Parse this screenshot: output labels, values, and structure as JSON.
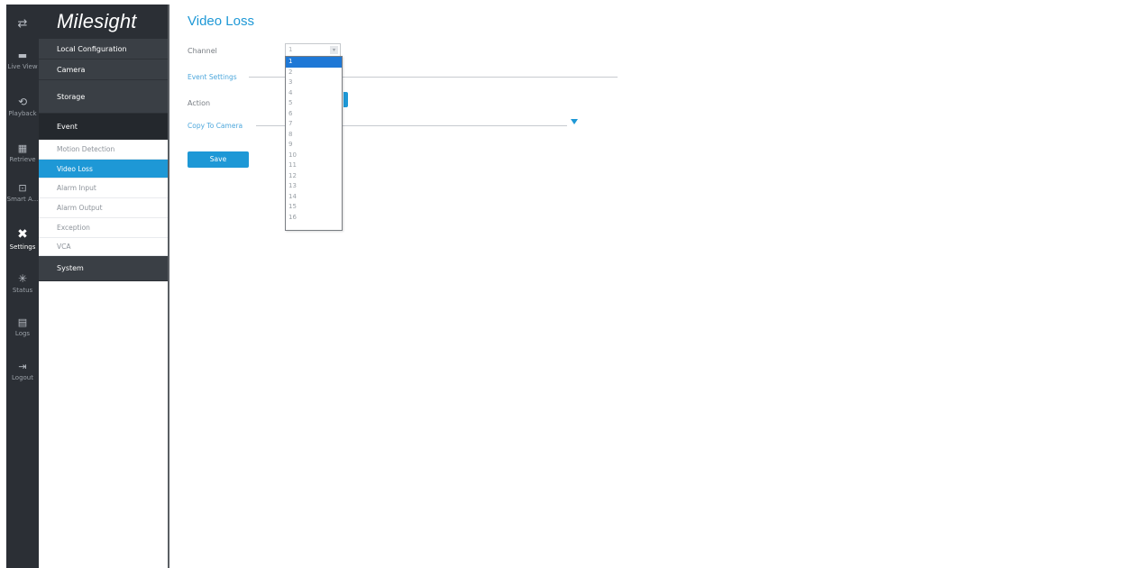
{
  "rail": [
    {
      "name": "menu-toggle",
      "label": ""
    },
    {
      "name": "live-view",
      "label": "Live View"
    },
    {
      "name": "playback",
      "label": "Playback"
    },
    {
      "name": "retrieve",
      "label": "Retrieve"
    },
    {
      "name": "smart-analysis",
      "label": "Smart A..."
    },
    {
      "name": "settings",
      "label": "Settings"
    },
    {
      "name": "status",
      "label": "Status"
    },
    {
      "name": "logs",
      "label": "Logs"
    },
    {
      "name": "logout",
      "label": "Logout"
    }
  ],
  "brand": {
    "logo_text": "Milesight"
  },
  "menu": {
    "local_configuration": "Local Configuration",
    "camera": "Camera",
    "storage": "Storage",
    "event": "Event",
    "event_items": [
      "Motion Detection",
      "Video Loss",
      "Alarm Input",
      "Alarm Output",
      "Exception",
      "VCA"
    ],
    "system": "System"
  },
  "main": {
    "title": "Video Loss",
    "channel_label": "Channel",
    "channel_value": "1",
    "event_settings": "Event Settings",
    "action_label": "Action",
    "copy_to_camera": "Copy To Camera",
    "save": "Save"
  },
  "dropdown": {
    "options": [
      "1",
      "2",
      "3",
      "4",
      "5",
      "6",
      "7",
      "8",
      "9",
      "10",
      "11",
      "12",
      "13",
      "14",
      "15",
      "16"
    ],
    "selected": "1"
  },
  "colors": {
    "accent": "#1e98d6",
    "rail_bg": "#2b2f35",
    "menu_head_bg": "#3a3f45"
  }
}
